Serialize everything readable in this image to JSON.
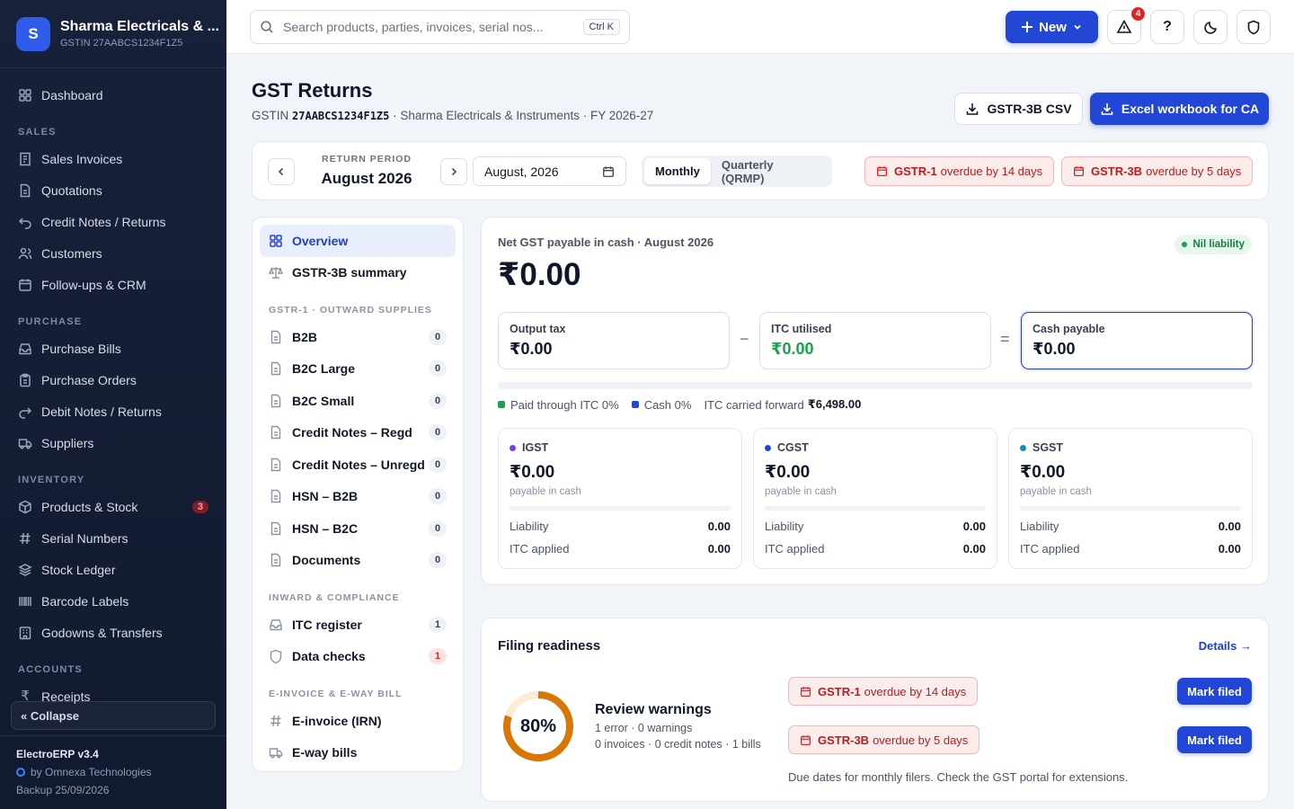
{
  "brand": {
    "logo": "S",
    "name": "Sharma Electricals & ...",
    "gstin": "GSTIN 27AABCS1234F1Z5"
  },
  "sidebar": {
    "dashboard": "Dashboard",
    "sections": [
      {
        "title": "SALES",
        "items": [
          {
            "label": "Sales Invoices",
            "icon": "invoice-icon"
          },
          {
            "label": "Quotations",
            "icon": "document-icon"
          },
          {
            "label": "Credit Notes / Returns",
            "icon": "return-icon"
          },
          {
            "label": "Customers",
            "icon": "users-icon"
          },
          {
            "label": "Follow-ups & CRM",
            "icon": "calendar-icon"
          }
        ]
      },
      {
        "title": "PURCHASE",
        "items": [
          {
            "label": "Purchase Bills",
            "icon": "inbox-icon"
          },
          {
            "label": "Purchase Orders",
            "icon": "clipboard-icon"
          },
          {
            "label": "Debit Notes / Returns",
            "icon": "forward-icon"
          },
          {
            "label": "Suppliers",
            "icon": "truck-icon"
          }
        ]
      },
      {
        "title": "INVENTORY",
        "items": [
          {
            "label": "Products & Stock",
            "icon": "box-icon",
            "badge": "3"
          },
          {
            "label": "Serial Numbers",
            "icon": "hash-icon"
          },
          {
            "label": "Stock Ledger",
            "icon": "layers-icon"
          },
          {
            "label": "Barcode Labels",
            "icon": "barcode-icon"
          },
          {
            "label": "Godowns & Transfers",
            "icon": "building-icon"
          }
        ]
      },
      {
        "title": "ACCOUNTS",
        "items": [
          {
            "label": "Receipts",
            "icon": "rupee-icon"
          }
        ]
      }
    ],
    "collapse": "« Collapse",
    "footer": {
      "version": "ElectroERP v3.4",
      "by": "by Omnexa Technologies",
      "backup": "Backup 25/09/2026"
    }
  },
  "topbar": {
    "search_placeholder": "Search products, parties, invoices, serial nos...",
    "shortcut": "Ctrl K",
    "new_label": "New",
    "alert_count": "4",
    "help": "?"
  },
  "header": {
    "title": "GST Returns",
    "gstin_prefix": "GSTIN ",
    "gstin": "27AABCS1234F1Z5",
    "subtitle_rest": " · Sharma Electricals & Instruments · FY 2026-27",
    "csv_btn": "GSTR-3B CSV",
    "excel_btn": "Excel workbook for CA"
  },
  "period": {
    "label": "RETURN PERIOD",
    "value": "August 2026",
    "month_input": "August, 2026",
    "modes": [
      "Monthly",
      "Quarterly (QRMP)"
    ],
    "overdue": [
      {
        "form": "GSTR-1",
        "text": "overdue by 14 days"
      },
      {
        "form": "GSTR-3B",
        "text": "overdue by 5 days"
      }
    ]
  },
  "menu": {
    "top": [
      {
        "label": "Overview",
        "icon": "grid-icon"
      },
      {
        "label": "GSTR-3B summary",
        "icon": "scale-icon"
      }
    ],
    "sec1": "GSTR-1 · OUTWARD SUPPLIES",
    "outward": [
      {
        "label": "B2B",
        "count": "0"
      },
      {
        "label": "B2C Large",
        "count": "0"
      },
      {
        "label": "B2C Small",
        "count": "0"
      },
      {
        "label": "Credit Notes – Regd",
        "count": "0"
      },
      {
        "label": "Credit Notes – Unregd",
        "count": "0"
      },
      {
        "label": "HSN – B2B",
        "count": "0"
      },
      {
        "label": "HSN – B2C",
        "count": "0"
      },
      {
        "label": "Documents",
        "count": "0"
      }
    ],
    "sec2": "INWARD & COMPLIANCE",
    "inward": [
      {
        "label": "ITC register",
        "count": "1",
        "icon": "inbox-icon"
      },
      {
        "label": "Data checks",
        "count": "1",
        "icon": "shield-icon"
      }
    ],
    "sec3": "E-INVOICE & E-WAY BILL",
    "einv": [
      {
        "label": "E-invoice (IRN)",
        "icon": "hash-icon"
      },
      {
        "label": "E-way bills",
        "icon": "truck-icon"
      }
    ]
  },
  "net": {
    "label": "Net GST payable in cash · August 2026",
    "amount": "₹0.00",
    "status": "Nil liability",
    "boxes": [
      {
        "title": "Output tax",
        "value": "₹0.00"
      },
      {
        "title": "ITC utilised",
        "value": "₹0.00"
      },
      {
        "title": "Cash payable",
        "value": "₹0.00"
      }
    ],
    "minus": "−",
    "equals": "=",
    "legend": {
      "itc": "Paid through ITC 0%",
      "cash": "Cash 0%",
      "cf_label": "ITC carried forward",
      "cf_value": "₹6,498.00"
    },
    "taxes": [
      {
        "name": "IGST",
        "amount": "₹0.00",
        "sub": "payable in cash",
        "liability": "0.00",
        "itc": "0.00",
        "color": "#7c3aed"
      },
      {
        "name": "CGST",
        "amount": "₹0.00",
        "sub": "payable in cash",
        "liability": "0.00",
        "itc": "0.00",
        "color": "#2246d6"
      },
      {
        "name": "SGST",
        "amount": "₹0.00",
        "sub": "payable in cash",
        "liability": "0.00",
        "itc": "0.00",
        "color": "#0891b2"
      }
    ],
    "liability_label": "Liability",
    "itc_label": "ITC applied"
  },
  "readiness": {
    "title": "Filing readiness",
    "details": "Details →",
    "percent": "80%",
    "percent_value": 80,
    "warn_title": "Review warnings",
    "line1": "1 error · 0 warnings",
    "line2": "0 invoices · 0 credit notes · 1 bills",
    "rows": [
      {
        "form": "GSTR-1",
        "text": "overdue by 14 days",
        "action": "Mark filed"
      },
      {
        "form": "GSTR-3B",
        "text": "overdue by 5 days",
        "action": "Mark filed"
      }
    ],
    "note": "Due dates for monthly filers. Check the GST portal for extensions."
  }
}
